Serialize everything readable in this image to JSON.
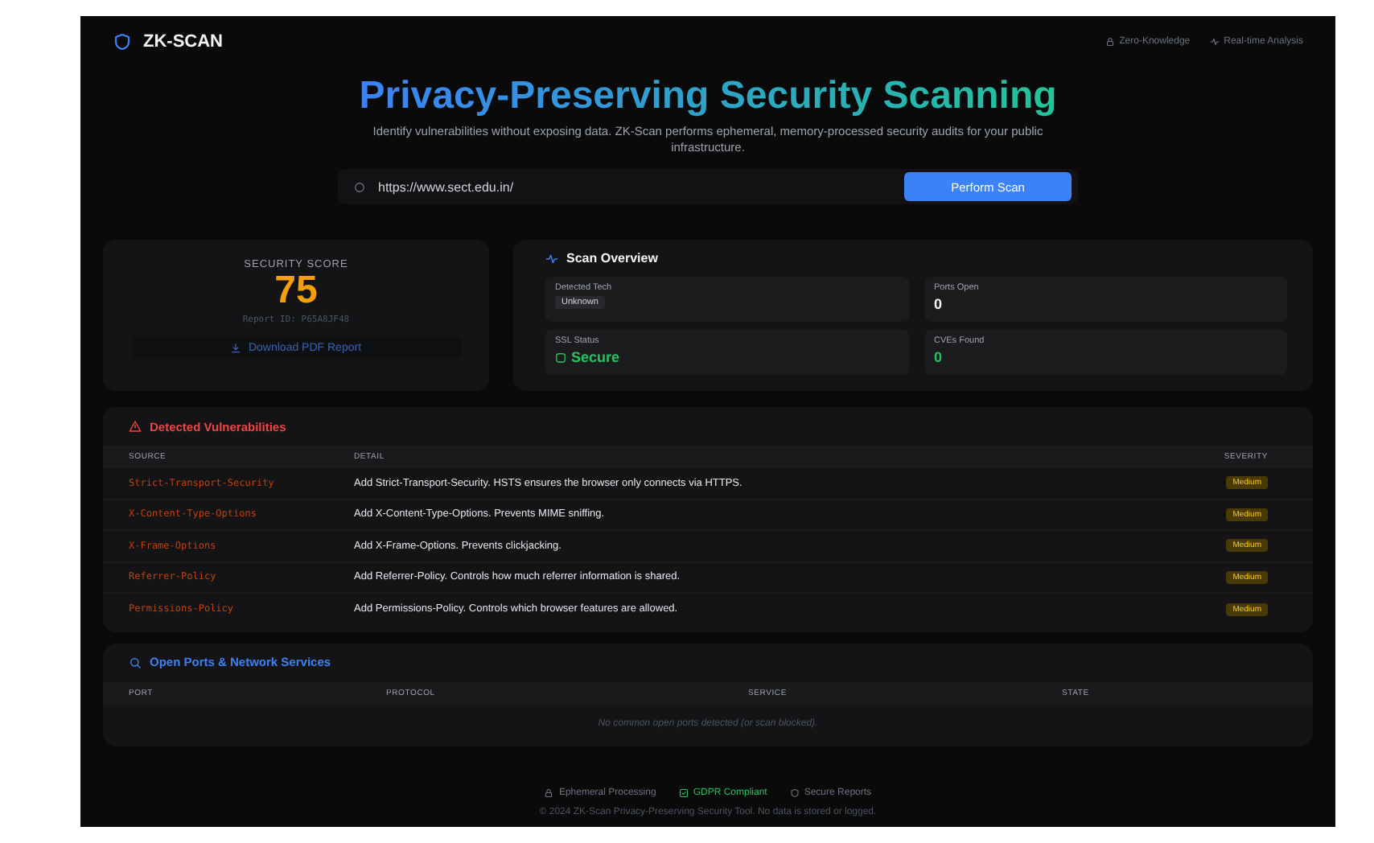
{
  "header": {
    "brand": "ZK-SCAN",
    "badges": [
      {
        "kind": "lock",
        "label": "Zero-Knowledge"
      },
      {
        "kind": "pulse",
        "label": "Real-time Analysis"
      }
    ]
  },
  "hero": {
    "title": "Privacy-Preserving Security Scanning",
    "subtitle": "Identify vulnerabilities without exposing data. ZK-Scan performs ephemeral, memory-processed security audits for your public infrastructure."
  },
  "scan": {
    "value": "https://www.sect.edu.in/",
    "button": "Perform Scan"
  },
  "score": {
    "label": "SECURITY SCORE",
    "value": "75",
    "report_id": "Report ID: P65A8JF48",
    "download": "Download PDF Report"
  },
  "overview": {
    "title": "Scan Overview",
    "stats": [
      {
        "label": "Detected Tech",
        "value": "Unknown",
        "kind": "tag"
      },
      {
        "label": "Ports Open",
        "value": "0",
        "kind": "plain"
      },
      {
        "label": "SSL Status",
        "value": "Secure",
        "kind": "secure"
      },
      {
        "label": "CVEs Found",
        "value": "0",
        "kind": "good"
      }
    ]
  },
  "vulnerabilities": {
    "title": "Detected Vulnerabilities",
    "columns": [
      "SOURCE",
      "DETAIL",
      "SEVERITY"
    ],
    "rows": [
      {
        "source": "Strict-Transport-Security",
        "detail": "Add Strict-Transport-Security. HSTS ensures the browser only connects via HTTPS.",
        "severity": "Medium"
      },
      {
        "source": "X-Content-Type-Options",
        "detail": "Add X-Content-Type-Options. Prevents MIME sniffing.",
        "severity": "Medium"
      },
      {
        "source": "X-Frame-Options",
        "detail": "Add X-Frame-Options. Prevents clickjacking.",
        "severity": "Medium"
      },
      {
        "source": "Referrer-Policy",
        "detail": "Add Referrer-Policy. Controls how much referrer information is shared.",
        "severity": "Medium"
      },
      {
        "source": "Permissions-Policy",
        "detail": "Add Permissions-Policy. Controls which browser features are allowed.",
        "severity": "Medium"
      }
    ]
  },
  "ports": {
    "title": "Open Ports & Network Services",
    "columns": [
      "PORT",
      "PROTOCOL",
      "SERVICE",
      "STATE"
    ],
    "empty": "No common open ports detected (or scan blocked)."
  },
  "footer": {
    "badges": [
      {
        "kind": "lock",
        "label": "Ephemeral Processing"
      },
      {
        "kind": "gdpr",
        "label": "GDPR Compliant"
      },
      {
        "kind": "shield",
        "label": "Secure Reports"
      }
    ],
    "copyright": "© 2024 ZK-Scan Privacy-Preserving Security Tool. No data is stored or logged."
  }
}
